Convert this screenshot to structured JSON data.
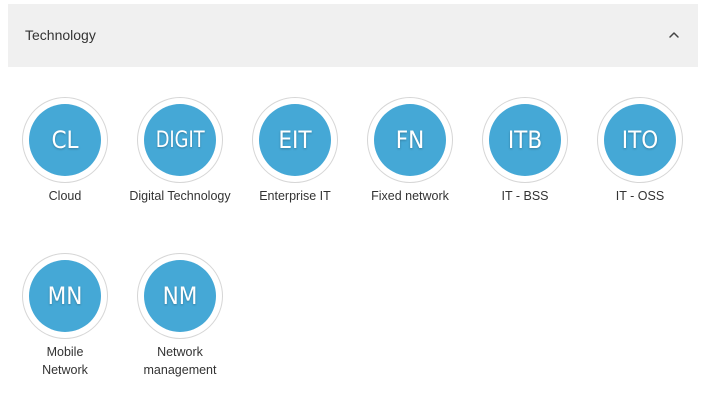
{
  "section": {
    "title": "Technology",
    "chevron_icon": "chevron-up-icon",
    "expanded": true
  },
  "colors": {
    "circle_fill": "#45a8d6",
    "header_bg": "#f0f0f0",
    "text": "#333333"
  },
  "items": [
    {
      "abbr": "CL",
      "label": "Cloud"
    },
    {
      "abbr": "DIGIT",
      "label": "Digital Technology"
    },
    {
      "abbr": "EIT",
      "label": "Enterprise IT"
    },
    {
      "abbr": "FN",
      "label": "Fixed network"
    },
    {
      "abbr": "ITB",
      "label": "IT - BSS"
    },
    {
      "abbr": "ITO",
      "label": "IT - OSS"
    },
    {
      "abbr": "MN",
      "label": "Mobile Network"
    },
    {
      "abbr": "NM",
      "label": "Network management"
    }
  ]
}
